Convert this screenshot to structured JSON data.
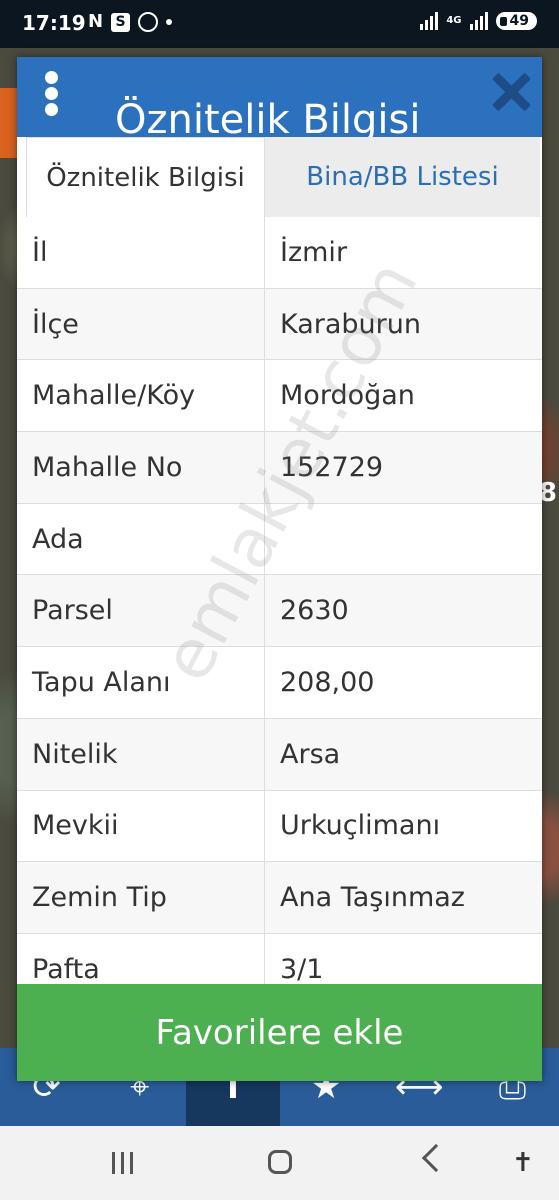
{
  "status_bar": {
    "time": "17:19",
    "left_icons": [
      "N",
      "S"
    ],
    "network": "4G",
    "battery": "49"
  },
  "map": {
    "edge_number": "8"
  },
  "dialog": {
    "header_title": "Öznitelik Bilgisi",
    "menu_icon": "more-vertical-icon",
    "close_icon": "close-icon",
    "tabs": [
      {
        "label": "Öznitelik Bilgisi",
        "active": true
      },
      {
        "label": "Bina/BB Listesi",
        "active": false
      }
    ],
    "rows": [
      {
        "key": "İl",
        "value": "İzmir"
      },
      {
        "key": "İlçe",
        "value": "Karaburun"
      },
      {
        "key": "Mahalle/Köy",
        "value": "Mordoğan"
      },
      {
        "key": "Mahalle No",
        "value": "152729"
      },
      {
        "key": "Ada",
        "value": ""
      },
      {
        "key": "Parsel",
        "value": "2630"
      },
      {
        "key": "Tapu Alanı",
        "value": "208,00"
      },
      {
        "key": "Nitelik",
        "value": "Arsa"
      },
      {
        "key": "Mevkii",
        "value": "Urkuçlimanı"
      },
      {
        "key": "Zemin Tip",
        "value": "Ana Taşınmaz"
      },
      {
        "key": "Pafta",
        "value": "3/1"
      }
    ],
    "watermark": "emlakjet.com",
    "favorite_button": "Favorilere ekle"
  },
  "toolbar": {
    "buttons": [
      {
        "icon": "refresh-icon",
        "glyph": "⟳"
      },
      {
        "icon": "locate-icon",
        "glyph": "⌖"
      },
      {
        "icon": "info-icon",
        "glyph": "ı",
        "active": true
      },
      {
        "icon": "star-icon",
        "glyph": "★"
      },
      {
        "icon": "measure-icon",
        "glyph": "⟷"
      },
      {
        "icon": "print-icon",
        "glyph": "⎙"
      }
    ]
  },
  "colors": {
    "header": "#2c71bd",
    "toolbar": "#2a5c9a",
    "favorite": "#4caf50",
    "tab_link": "#2a6fb5"
  }
}
